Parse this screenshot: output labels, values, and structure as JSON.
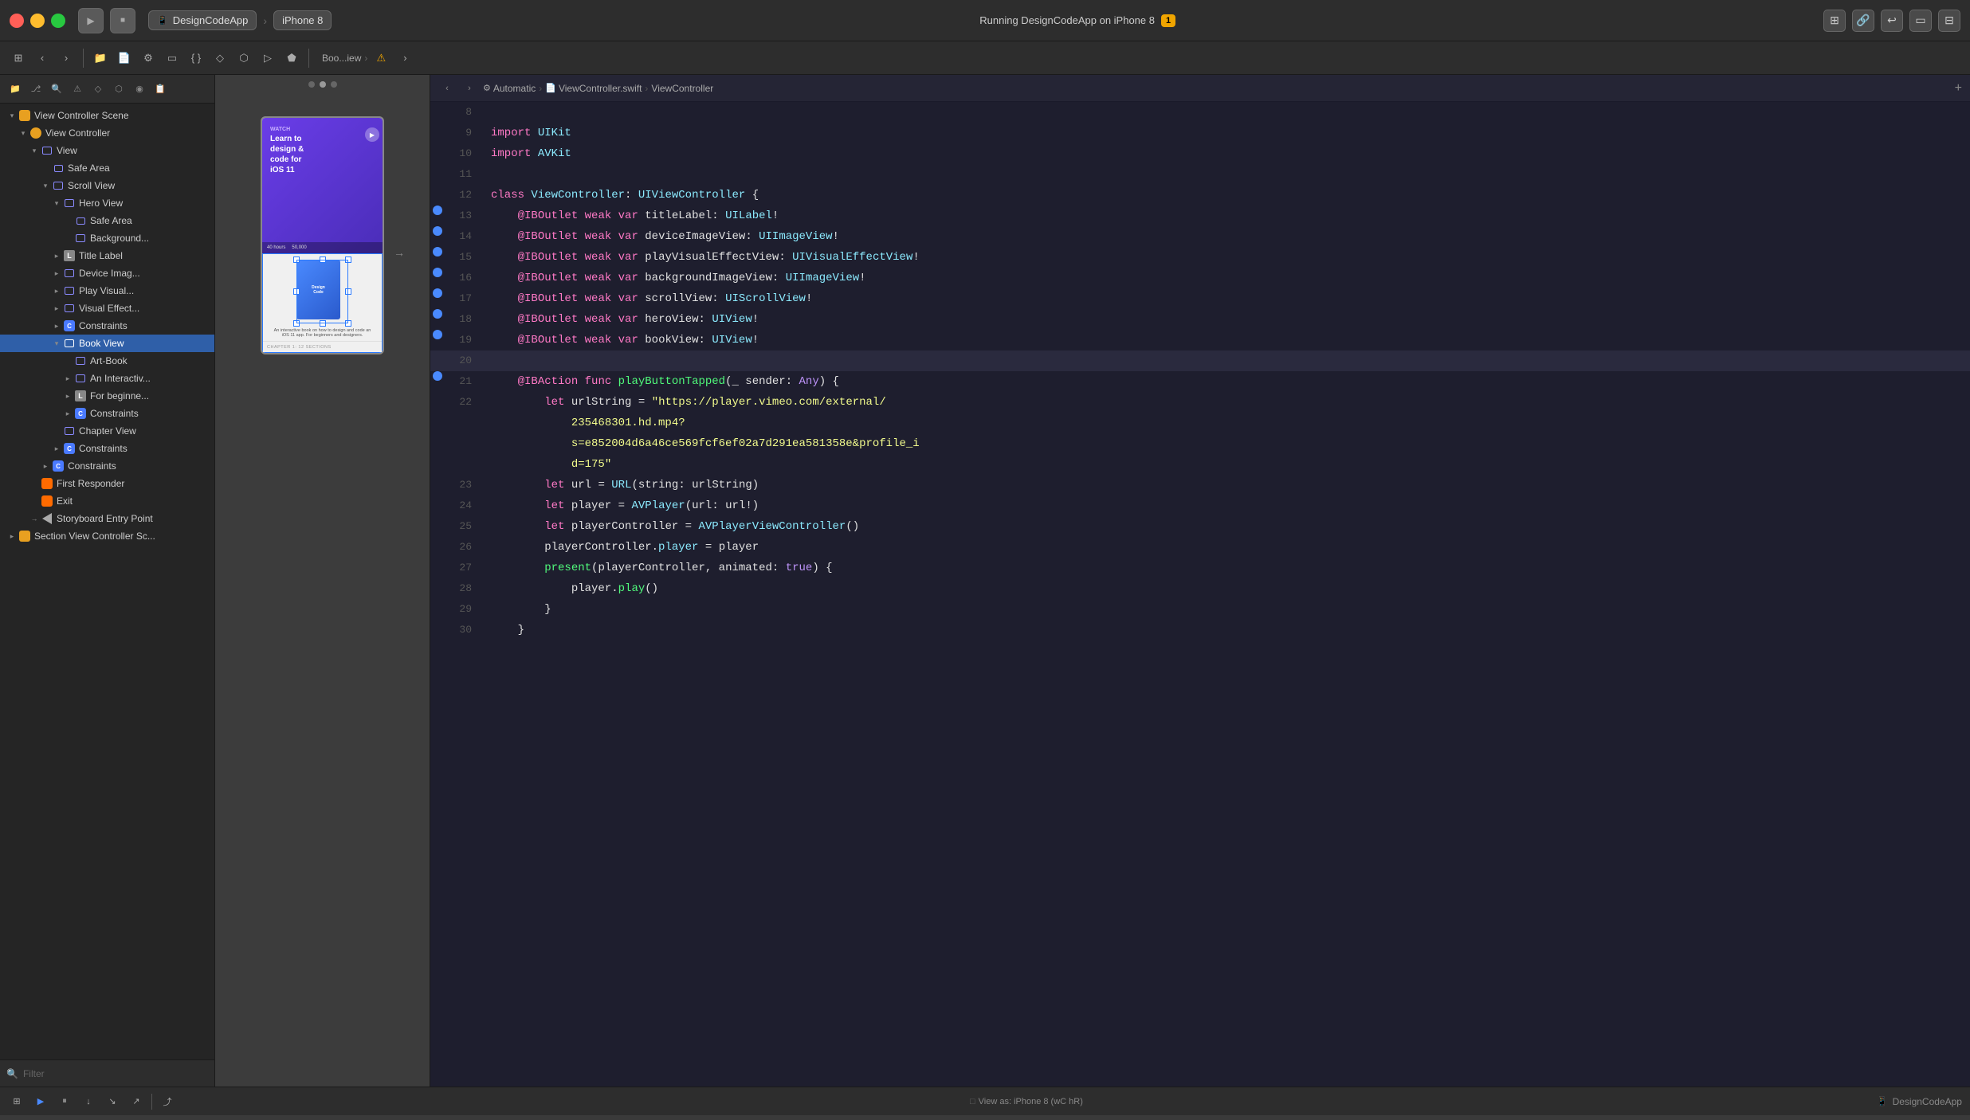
{
  "titlebar": {
    "app_name": "DesignCodeApp",
    "device": "iPhone 8",
    "running_label": "Running DesignCodeApp on iPhone 8",
    "warning_count": "1",
    "play_icon": "▶",
    "stop_icon": "■"
  },
  "toolbar": {
    "back_icon": "‹",
    "forward_icon": "›",
    "breadcrumb": [
      "Boo...iew"
    ],
    "editor_mode": "Automatic",
    "file_name": "ViewController.swift",
    "symbol": "ViewController"
  },
  "navigator": {
    "filter_placeholder": "Filter",
    "tree": [
      {
        "id": "vc-scene",
        "label": "View Controller Scene",
        "indent": 0,
        "expanded": true,
        "icon": "scene",
        "type": "group"
      },
      {
        "id": "vc",
        "label": "View Controller",
        "indent": 1,
        "expanded": true,
        "icon": "vc",
        "type": "vc"
      },
      {
        "id": "view",
        "label": "View",
        "indent": 2,
        "expanded": true,
        "icon": "view",
        "type": "view"
      },
      {
        "id": "safe-area",
        "label": "Safe Area",
        "indent": 3,
        "icon": "safe",
        "type": "view"
      },
      {
        "id": "scroll-view",
        "label": "Scroll View",
        "indent": 3,
        "expanded": true,
        "icon": "scroll",
        "type": "view"
      },
      {
        "id": "hero-view",
        "label": "Hero View",
        "indent": 4,
        "expanded": true,
        "icon": "view",
        "type": "view"
      },
      {
        "id": "safe-area2",
        "label": "Safe Area",
        "indent": 5,
        "icon": "safe",
        "type": "view"
      },
      {
        "id": "background",
        "label": "Background...",
        "indent": 5,
        "icon": "view",
        "type": "view"
      },
      {
        "id": "title-label",
        "label": "Title Label",
        "indent": 4,
        "icon": "label-l",
        "type": "label",
        "has_arrow": true
      },
      {
        "id": "device-img",
        "label": "Device Imag...",
        "indent": 4,
        "icon": "view",
        "type": "view",
        "has_arrow": true
      },
      {
        "id": "play-visual",
        "label": "Play Visual...",
        "indent": 4,
        "icon": "view",
        "type": "view",
        "has_arrow": true
      },
      {
        "id": "visual-effect",
        "label": "Visual Effect...",
        "indent": 4,
        "icon": "view",
        "type": "view",
        "has_arrow": true
      },
      {
        "id": "constraints1",
        "label": "Constraints",
        "indent": 4,
        "icon": "constraint",
        "type": "constraint",
        "has_arrow": true
      },
      {
        "id": "book-view",
        "label": "Book View",
        "indent": 4,
        "expanded": true,
        "icon": "view",
        "type": "view",
        "selected": true
      },
      {
        "id": "art-book",
        "label": "Art-Book",
        "indent": 5,
        "icon": "view",
        "type": "view"
      },
      {
        "id": "an-interactive",
        "label": "An Interactiv...",
        "indent": 5,
        "icon": "view",
        "type": "view",
        "has_arrow": true
      },
      {
        "id": "for-beginners",
        "label": "For beginne...",
        "indent": 5,
        "icon": "label-l",
        "type": "label",
        "has_arrow": true
      },
      {
        "id": "constraints2",
        "label": "Constraints",
        "indent": 5,
        "icon": "constraint",
        "type": "constraint",
        "has_arrow": true
      },
      {
        "id": "chapter-view",
        "label": "Chapter View",
        "indent": 4,
        "icon": "view",
        "type": "view"
      },
      {
        "id": "constraints3",
        "label": "Constraints",
        "indent": 4,
        "icon": "constraint",
        "type": "constraint",
        "has_arrow": true
      },
      {
        "id": "constraints4",
        "label": "Constraints",
        "indent": 3,
        "icon": "constraint",
        "type": "constraint",
        "has_arrow": true
      },
      {
        "id": "first-responder",
        "label": "First Responder",
        "indent": 2,
        "icon": "responder",
        "type": "responder"
      },
      {
        "id": "exit",
        "label": "Exit",
        "indent": 2,
        "icon": "exit",
        "type": "exit"
      },
      {
        "id": "storyboard-entry",
        "label": "Storyboard Entry Point",
        "indent": 2,
        "icon": "entry",
        "type": "entry"
      },
      {
        "id": "section-vc-scene",
        "label": "Section View Controller Sc...",
        "indent": 0,
        "icon": "scene",
        "type": "group",
        "has_arrow": true
      }
    ]
  },
  "canvas": {
    "view_as_label": "View as: iPhone 8 (wC hR)"
  },
  "code": {
    "file": "ViewController.swift",
    "symbol": "ViewController",
    "mode": "Automatic",
    "lines": [
      {
        "num": 8,
        "content": "",
        "has_bp": false
      },
      {
        "num": 9,
        "content": "import UIKit",
        "has_bp": false
      },
      {
        "num": 10,
        "content": "import AVKit",
        "has_bp": false
      },
      {
        "num": 11,
        "content": "",
        "has_bp": false
      },
      {
        "num": 12,
        "content": "class ViewController: UIViewController {",
        "has_bp": false
      },
      {
        "num": 13,
        "content": "    @IBOutlet weak var titleLabel: UILabel!",
        "has_bp": true
      },
      {
        "num": 14,
        "content": "    @IBOutlet weak var deviceImageView: UIImageView!",
        "has_bp": true
      },
      {
        "num": 15,
        "content": "    @IBOutlet weak var playVisualEffectView: UIVisualEffectView!",
        "has_bp": true
      },
      {
        "num": 16,
        "content": "    @IBOutlet weak var backgroundImageView: UIImageView!",
        "has_bp": true
      },
      {
        "num": 17,
        "content": "    @IBOutlet weak var scrollView: UIScrollView!",
        "has_bp": true
      },
      {
        "num": 18,
        "content": "    @IBOutlet weak var heroView: UIView!",
        "has_bp": true
      },
      {
        "num": 19,
        "content": "    @IBOutlet weak var bookView: UIView!",
        "has_bp": true
      },
      {
        "num": 20,
        "content": "",
        "has_bp": false,
        "highlighted": true
      },
      {
        "num": 21,
        "content": "    @IBAction func playButtonTapped(_ sender: Any) {",
        "has_bp": true
      },
      {
        "num": 22,
        "content": "        let urlString = \"https://player.vimeo.com/external/235468301.hd.mp4?s=e852004d6a46ce569fcf6ef02a7d291ea581358e&profile_id=175\"",
        "has_bp": false
      },
      {
        "num": 23,
        "content": "        let url = URL(string: urlString)",
        "has_bp": false
      },
      {
        "num": 24,
        "content": "        let player = AVPlayer(url: url!)",
        "has_bp": false
      },
      {
        "num": 25,
        "content": "        let playerController = AVPlayerViewController()",
        "has_bp": false
      },
      {
        "num": 26,
        "content": "        playerController.player = player",
        "has_bp": false
      },
      {
        "num": 27,
        "content": "        present(playerController, animated: true) {",
        "has_bp": false
      },
      {
        "num": 28,
        "content": "            player.play()",
        "has_bp": false
      },
      {
        "num": 29,
        "content": "        }",
        "has_bp": false
      },
      {
        "num": 30,
        "content": "    }",
        "has_bp": false
      }
    ]
  },
  "status_bar": {
    "view_as": "View as: iPhone 8 (wC hR)",
    "app_name": "DesignCodeApp"
  }
}
